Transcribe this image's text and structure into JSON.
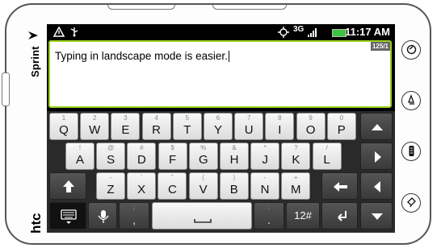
{
  "device": {
    "carrier_brand": "Sprint",
    "maker_brand": "htc"
  },
  "status_bar": {
    "network_type": "3G",
    "time": "11:17 AM"
  },
  "text_field": {
    "value": "Typing in landscape mode is easier.",
    "char_counter": "125/1"
  },
  "keyboard": {
    "row1": [
      {
        "main": "Q",
        "alt": "1"
      },
      {
        "main": "W",
        "alt": "2"
      },
      {
        "main": "E",
        "alt": "3"
      },
      {
        "main": "R",
        "alt": "4"
      },
      {
        "main": "T",
        "alt": "5"
      },
      {
        "main": "Y",
        "alt": "6"
      },
      {
        "main": "U",
        "alt": "7"
      },
      {
        "main": "I",
        "alt": "8"
      },
      {
        "main": "O",
        "alt": "9"
      },
      {
        "main": "P",
        "alt": "0"
      }
    ],
    "row2": [
      {
        "main": "A",
        "alt": "!"
      },
      {
        "main": "S",
        "alt": "@"
      },
      {
        "main": "D",
        "alt": "#"
      },
      {
        "main": "F",
        "alt": "$"
      },
      {
        "main": "G",
        "alt": "%"
      },
      {
        "main": "H",
        "alt": "&"
      },
      {
        "main": "J",
        "alt": "*"
      },
      {
        "main": "K",
        "alt": "?"
      },
      {
        "main": "L",
        "alt": "/"
      }
    ],
    "row3": [
      {
        "main": "Z",
        "alt": "-"
      },
      {
        "main": "X",
        "alt": "'"
      },
      {
        "main": "C",
        "alt": "\""
      },
      {
        "main": "V",
        "alt": "("
      },
      {
        "main": "B",
        "alt": ")"
      },
      {
        "main": "N",
        "alt": "-"
      },
      {
        "main": "M",
        "alt": "+"
      }
    ],
    "comma_key": {
      "main": ",",
      "alt": ";"
    },
    "period_key": {
      "main": ".",
      "alt": ":"
    },
    "numbers_key": "12#"
  },
  "icons": {
    "status": [
      "warning-icon",
      "usb-icon",
      "gps-icon",
      "signal-icon",
      "battery-icon"
    ],
    "hardware_buttons": [
      "home-icon",
      "menu-icon",
      "back-icon",
      "search-icon"
    ]
  }
}
